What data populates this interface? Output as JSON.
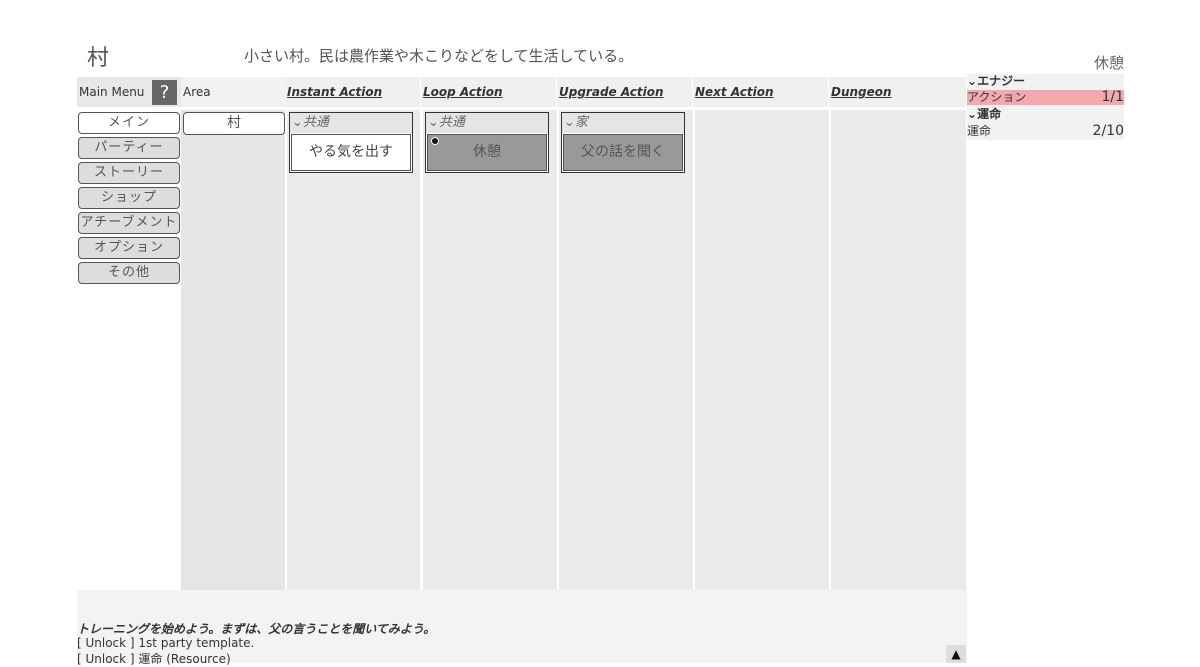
{
  "area": {
    "title": "村",
    "description": "小さい村。民は農作業や木こりなどをして生活している。"
  },
  "status": {
    "current": "休憩"
  },
  "menu": {
    "header_label": "Main Menu",
    "help_label": "?",
    "items": [
      {
        "label": "メイン"
      },
      {
        "label": "パーティー"
      },
      {
        "label": "ストーリー"
      },
      {
        "label": "ショップ"
      },
      {
        "label": "アチーブメント"
      },
      {
        "label": "オプション"
      },
      {
        "label": "その他"
      }
    ]
  },
  "area_column": {
    "header_label": "Area",
    "items": [
      {
        "label": "村"
      }
    ]
  },
  "columns": {
    "instant": {
      "label": "Instant Action",
      "group": "共通",
      "action": "やる気を出す"
    },
    "loop": {
      "label": "Loop Action",
      "group": "共通",
      "action": "休憩"
    },
    "upgrade": {
      "label": "Upgrade Action",
      "group": "家",
      "action": "父の話を聞く"
    },
    "next": {
      "label": "Next Action"
    },
    "dungeon": {
      "label": "Dungeon"
    }
  },
  "resources": {
    "energy_header": "エナジー",
    "energy_label": "アクション",
    "energy_value": "1/1",
    "fate_header": "運命",
    "fate_label": "運命",
    "fate_value": "2/10"
  },
  "log": {
    "message": "トレーニングを始めよう。まずは、父の言うことを聞いてみよう。",
    "lines": [
      "[ Unlock ] 1st party template.",
      "[ Unlock ] 運命 (Resource)"
    ],
    "scroll_icon": "▲"
  },
  "icons": {
    "chevron": "⌄"
  },
  "colors": {
    "energy_bar": "#f2a9ad",
    "active_button": "#999999"
  }
}
